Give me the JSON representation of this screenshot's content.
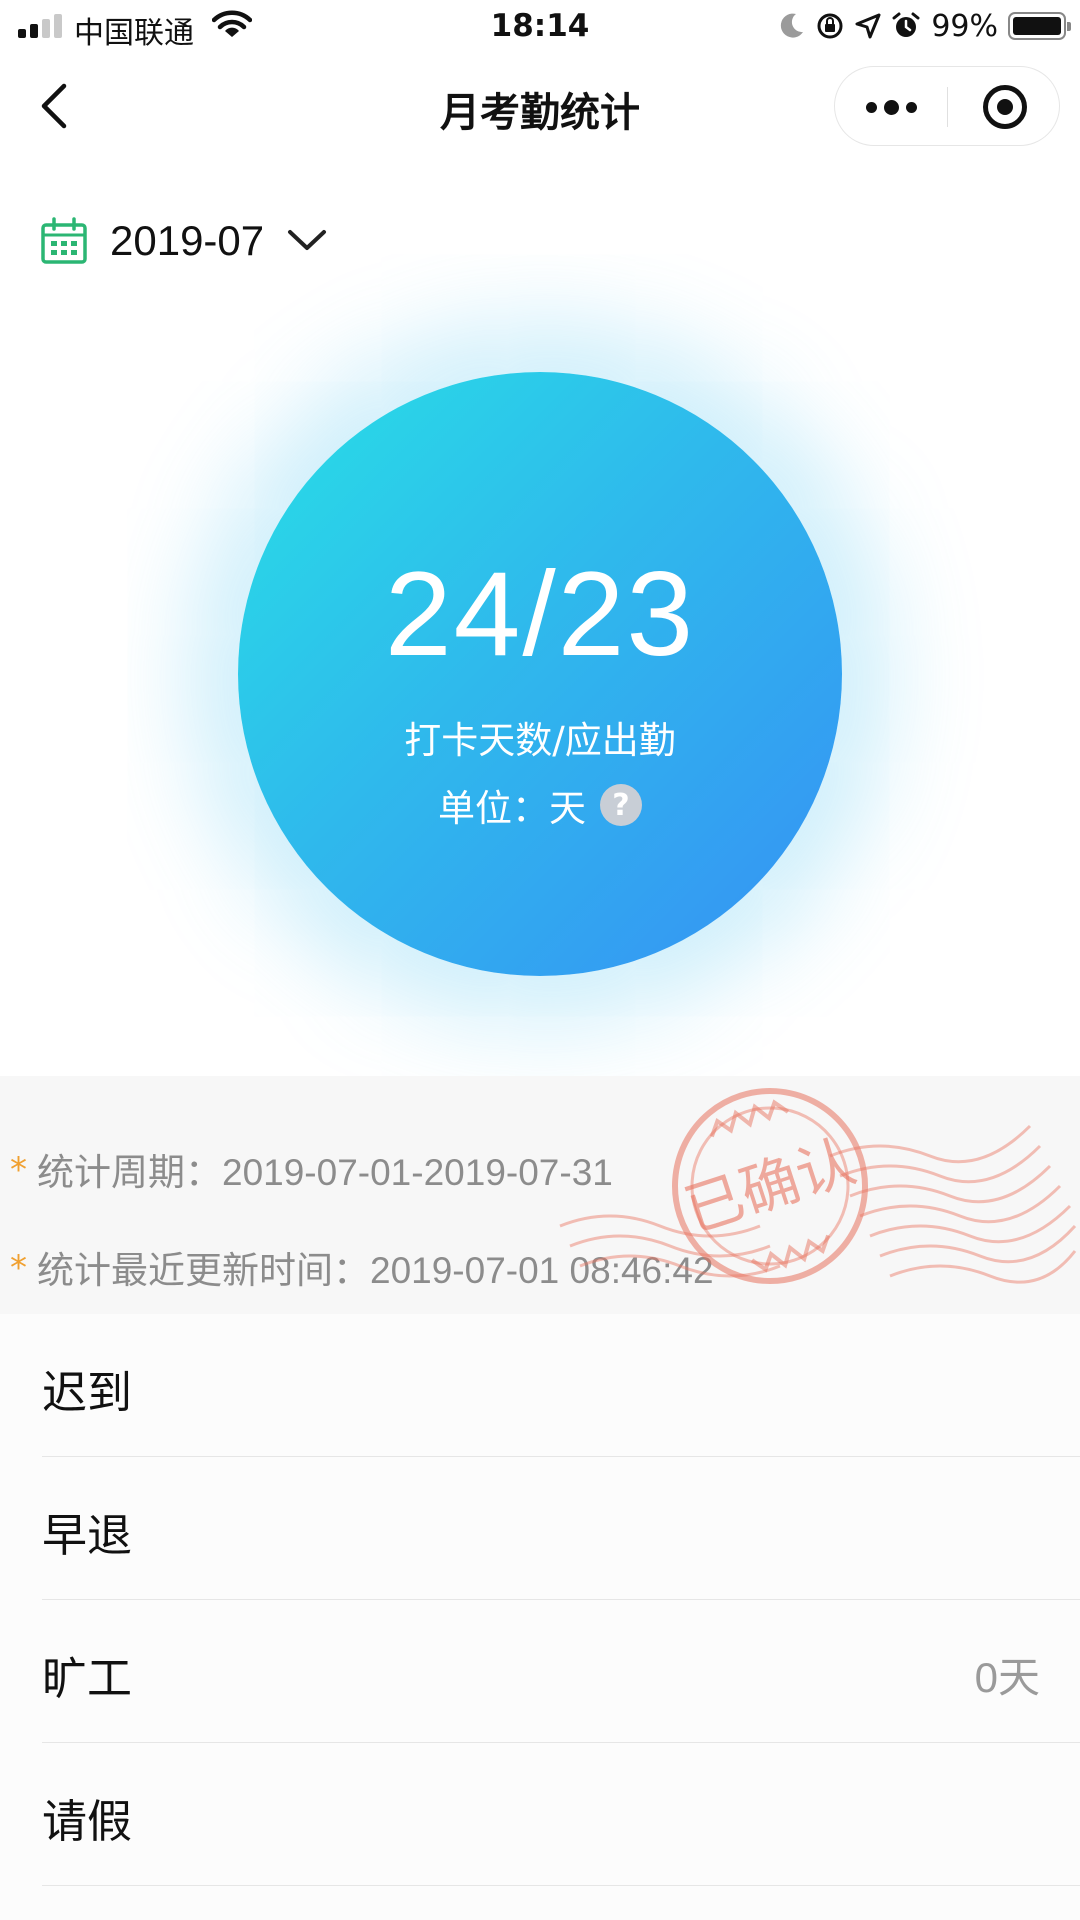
{
  "status_bar": {
    "carrier": "中国联通",
    "time": "18:14",
    "battery_percent": "99%",
    "battery_level": 0.99
  },
  "nav": {
    "title": "月考勤统计"
  },
  "month_selector": {
    "value": "2019-07"
  },
  "summary": {
    "count": "24/23",
    "label": "打卡天数/应出勤",
    "unit": "单位：天",
    "help": "?"
  },
  "info": {
    "period_label": "统计周期：",
    "period_value": "2019-07-01-2019-07-31",
    "updated_label": "统计最近更新时间：",
    "updated_value": "2019-07-01 08:46:42",
    "star": "*",
    "stamp_text": "已确认"
  },
  "list": [
    {
      "label": "迟到",
      "value": ""
    },
    {
      "label": "早退",
      "value": ""
    },
    {
      "label": "旷工",
      "value": "0天"
    },
    {
      "label": "请假",
      "value": ""
    }
  ],
  "colors": {
    "accent_green": "#2bb673",
    "circle_start": "#28e0e6",
    "circle_end": "#3690f5",
    "star_orange": "#f0a030",
    "stamp_red": "#e8735f"
  }
}
